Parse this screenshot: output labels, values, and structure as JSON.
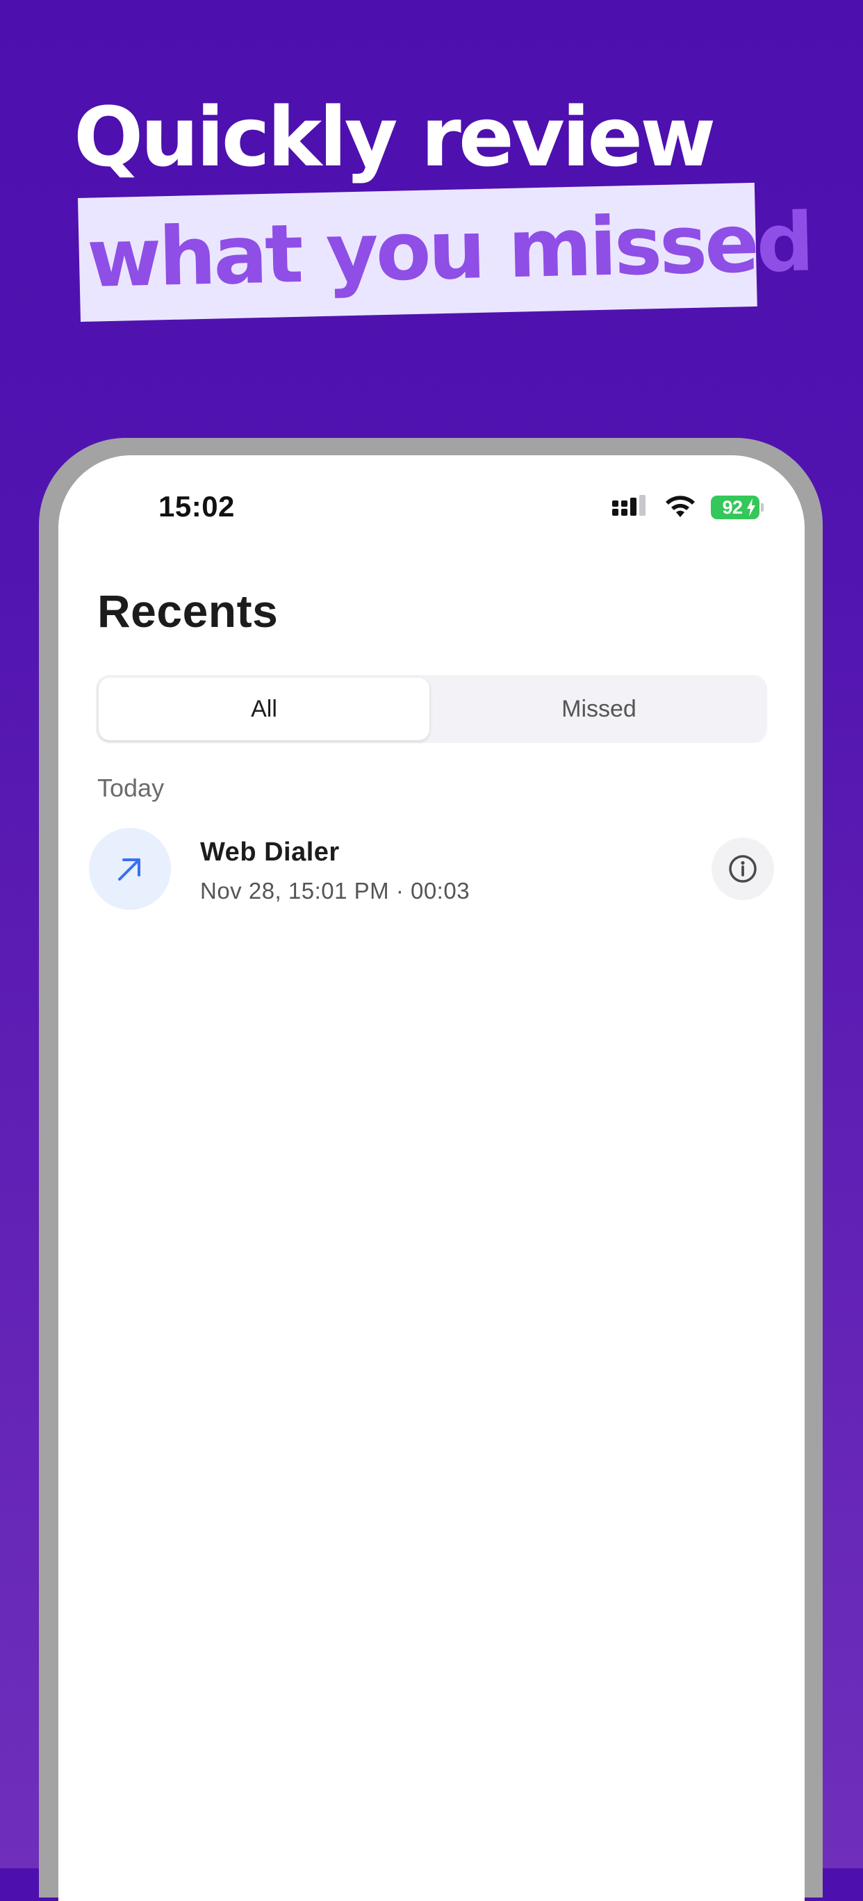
{
  "headline": {
    "line1": "Quickly review",
    "line2": "what you missed"
  },
  "status_bar": {
    "time": "15:02",
    "battery_level": "92",
    "icons": [
      "signal-icon",
      "wifi-icon",
      "battery-charging-icon"
    ]
  },
  "screen": {
    "title": "Recents",
    "segments": {
      "all_label": "All",
      "missed_label": "Missed",
      "selected": "All"
    },
    "section_header": "Today",
    "recents": [
      {
        "name": "Web Dialer",
        "details": "Nov 28, 15:01 PM · 00:03",
        "direction_icon": "outgoing-call-arrow-icon",
        "info_icon": "info-icon"
      }
    ]
  },
  "colors": {
    "background": "#5214b0",
    "headline_text": "#ffffff",
    "highlight_bg": "#ebe6ff",
    "highlight_text": "#8f4ee6",
    "battery": "#34c759",
    "call_arrow": "#3a6ff2"
  }
}
